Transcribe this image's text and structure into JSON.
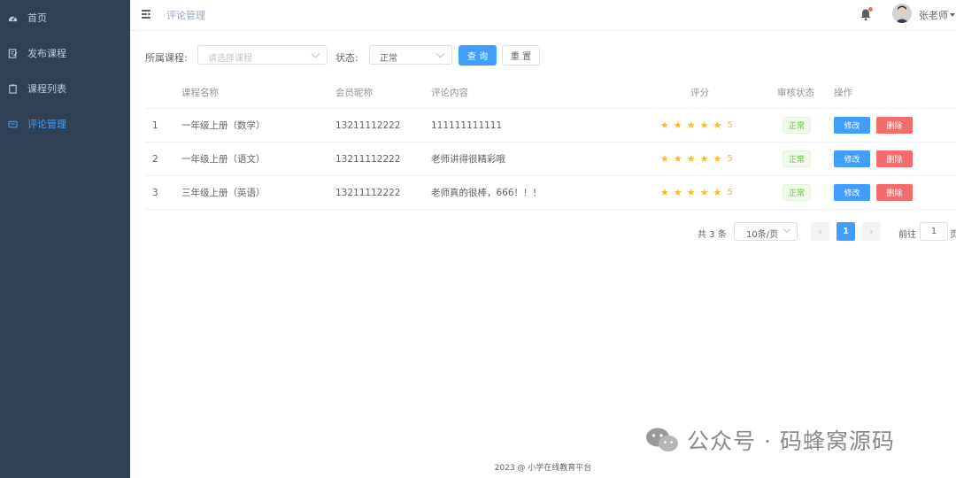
{
  "sidebar": {
    "items": [
      {
        "label": "首页",
        "icon": "dashboard-icon"
      },
      {
        "label": "发布课程",
        "icon": "edit-doc-icon"
      },
      {
        "label": "课程列表",
        "icon": "clipboard-icon"
      },
      {
        "label": "评论管理",
        "icon": "message-icon"
      }
    ],
    "active_index": 3,
    "background": "#304156",
    "active_color": "#409eff"
  },
  "header": {
    "breadcrumb": "评论管理",
    "user_name": "张老师"
  },
  "filter": {
    "course_label": "所属课程:",
    "course_placeholder": "请选择课程",
    "status_label": "状态:",
    "status_value": "正常",
    "search_button": "查 询",
    "reset_button": "重 置"
  },
  "table": {
    "headers": [
      "课程名称",
      "会员昵称",
      "评论内容",
      "评分",
      "审核状态",
      "操作"
    ],
    "rows": [
      {
        "index": "1",
        "course": "一年级上册（数学）",
        "member": "13211112222",
        "comment": "111111111111",
        "rating": 5,
        "score_text": "5",
        "status": "正常"
      },
      {
        "index": "2",
        "course": "一年级上册（语文）",
        "member": "13211112222",
        "comment": "老师讲得很精彩哦",
        "rating": 5,
        "score_text": "5",
        "status": "正常"
      },
      {
        "index": "3",
        "course": "三年级上册（英语）",
        "member": "13211112222",
        "comment": "老师真的很棒，666！！！",
        "rating": 5,
        "score_text": "5",
        "status": "正常"
      }
    ],
    "edit_label": "修改",
    "delete_label": "删除"
  },
  "pagination": {
    "total": "共 3 条",
    "page_size": "10条/页",
    "prev": "‹",
    "current_page": "1",
    "next": "›",
    "goto_label": "前往",
    "goto_value": "1",
    "goto_unit": "页"
  },
  "footer": {
    "text": "2023 @ 小学在线教育平台"
  },
  "watermark": {
    "text": "公众号 · 码蜂窝源码"
  }
}
